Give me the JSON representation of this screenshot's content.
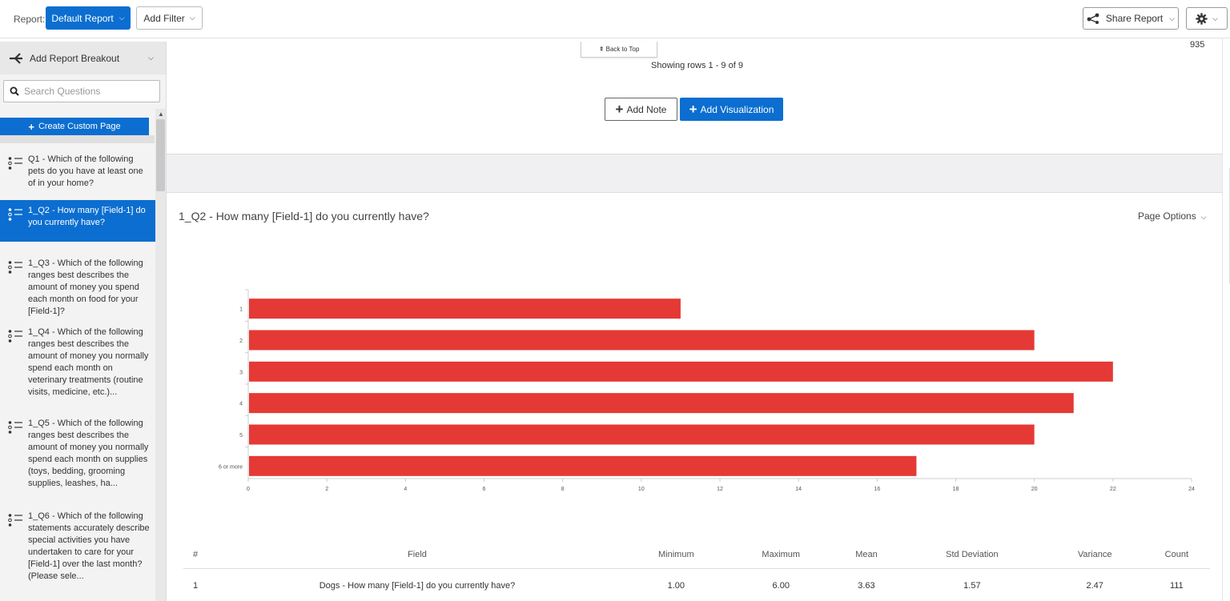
{
  "topbar": {
    "report_label": "Report:",
    "report_select": "Default Report",
    "add_filter": "Add Filter",
    "share_report": "Share Report"
  },
  "sidebar": {
    "breakout_label": "Add Report Breakout",
    "search_placeholder": "Search Questions",
    "create_custom_page": "Create Custom Page",
    "items": [
      {
        "label": "Q1 - Which of the following pets do you have at least one of in your home?",
        "active": false
      },
      {
        "label": "1_Q2 - How many [Field-1] do you currently have?",
        "active": true
      },
      {
        "label": "1_Q3 - Which of the following ranges best describes the amount of money you spend each month on food for your [Field-1]?",
        "active": false
      },
      {
        "label": "1_Q4 - Which of the following ranges best describes the amount of money you normally spend each month on veterinary treatments (routine visits, medicine, etc.)...",
        "active": false
      },
      {
        "label": "1_Q5 - Which of the following ranges best describes the amount of money you normally spend each month on supplies (toys, bedding, grooming supplies, leashes, ha...",
        "active": false
      },
      {
        "label": "1_Q6 - Which of the following statements accurately describe special activities you have undertaken to care for your [Field-1] over the last month? (Please sele...",
        "active": false
      }
    ]
  },
  "main": {
    "back_to_top": "⇞ Back to Top",
    "corner_number": "935",
    "showing_rows": "Showing rows 1 - 9 of 9",
    "add_note": "Add Note",
    "add_visualization": "Add Visualization",
    "page_title": "1_Q2 - How many [Field-1] do you currently have?",
    "page_options": "Page Options"
  },
  "chart_data": {
    "type": "bar",
    "orientation": "horizontal",
    "categories": [
      "1",
      "2",
      "3",
      "4",
      "5",
      "6 or more"
    ],
    "values": [
      11,
      20,
      22,
      21,
      20,
      17
    ],
    "xlim": [
      0,
      24
    ],
    "xticks": [
      0,
      2,
      4,
      6,
      8,
      10,
      12,
      14,
      16,
      18,
      20,
      22,
      24
    ],
    "color": "#e53935",
    "grid": false
  },
  "stats_table": {
    "headers": [
      "#",
      "Field",
      "Minimum",
      "Maximum",
      "Mean",
      "Std Deviation",
      "Variance",
      "Count"
    ],
    "rows": [
      [
        "1",
        "Dogs - How many [Field-1] do you currently have?",
        "1.00",
        "6.00",
        "3.63",
        "1.57",
        "2.47",
        "111"
      ]
    ]
  },
  "colors": {
    "accent": "#0b6ed0",
    "bar": "#e53935"
  }
}
